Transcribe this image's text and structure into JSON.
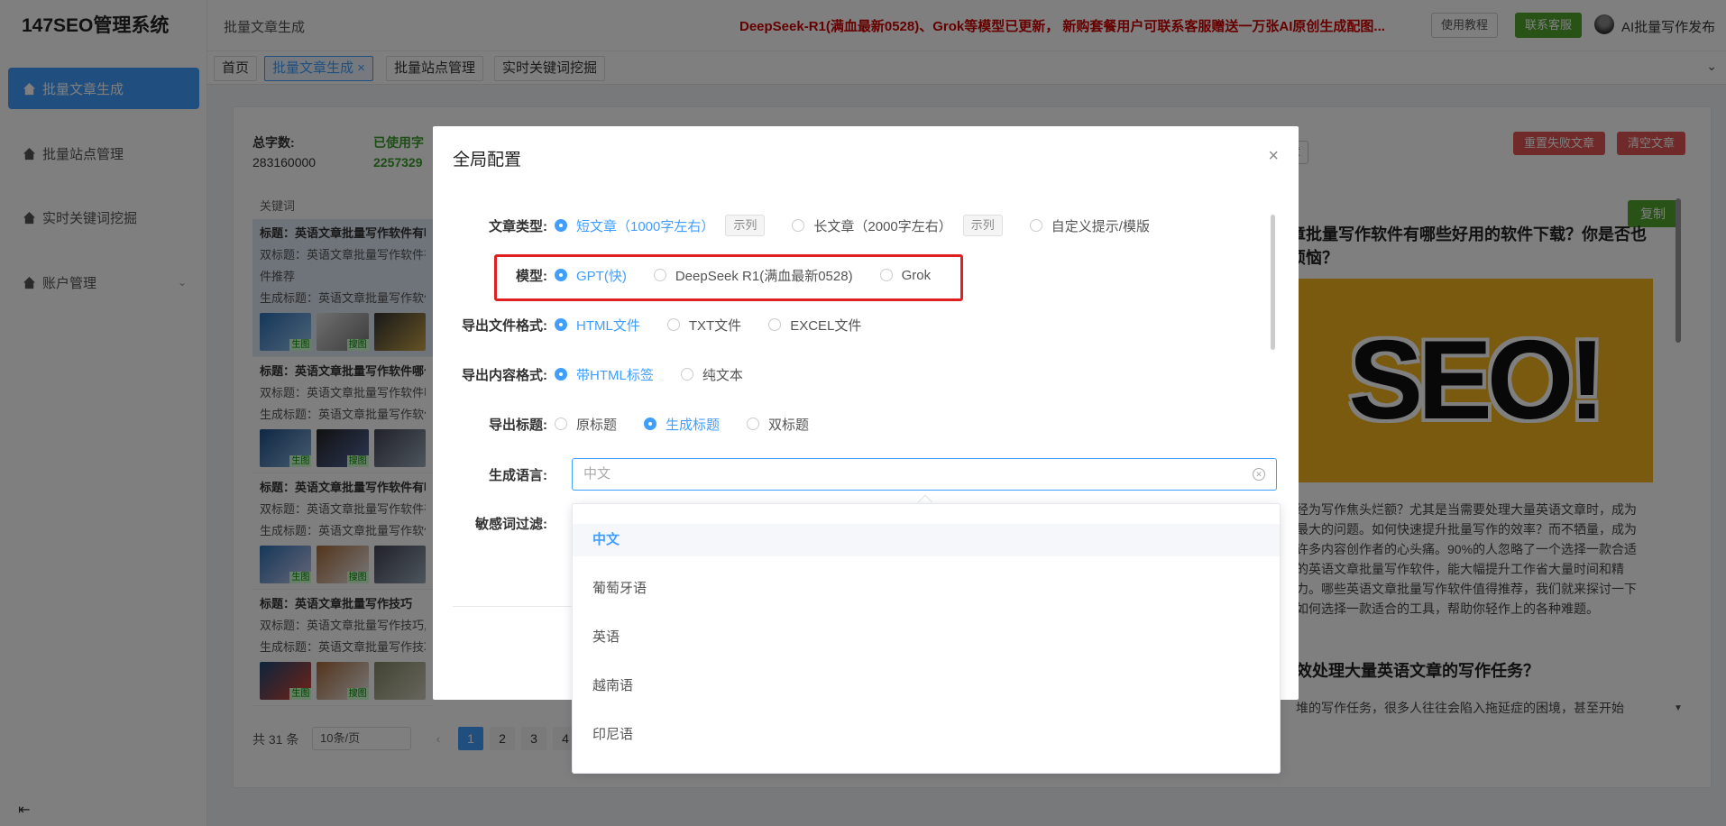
{
  "app": {
    "title": "147SEO管理系统"
  },
  "sidebar": {
    "items": [
      {
        "label": "批量文章生成"
      },
      {
        "label": "批量站点管理"
      },
      {
        "label": "实时关键词挖掘"
      },
      {
        "label": "账户管理"
      }
    ]
  },
  "header": {
    "breadcrumb": "批量文章生成",
    "notice": "DeepSeek-R1(满血最新0528)、Grok等模型已更新， 新购套餐用户可联系客服赠送一万张AI原创生成配图...",
    "tutorial_label": "使用教程",
    "service_label": "联系客服",
    "user_label": "AI批量写作发布"
  },
  "tabs": [
    {
      "label": "首页"
    },
    {
      "label": "批量文章生成 ×"
    },
    {
      "label": "批量站点管理"
    },
    {
      "label": "实时关键词挖掘"
    }
  ],
  "stats": {
    "total_words_label": "总字数:",
    "total_words_value": "283160000",
    "used_label": "已使用字",
    "used_value": "2257329"
  },
  "actions": {
    "reset_failed": "重置失败文章",
    "clear": "清空文章",
    "partial": "章",
    "copy": "复制"
  },
  "list": {
    "header": "关键词",
    "items": [
      {
        "title": "标题：英语文章批量写作软件有哪",
        "dual": "双标题：英语文章批量写作软件有",
        "extra": "件推荐",
        "gen": "生成标题：英语文章批量写作软件"
      },
      {
        "title": "标题：英语文章批量写作软件哪个",
        "dual": "双标题：英语文章批量写作软件哪",
        "gen": "生成标题：英语文章批量写作软件"
      },
      {
        "title": "标题：英语文章批量写作软件有哪",
        "dual": "双标题：英语文章批量写作软件有",
        "gen": "生成标题：英语文章批量写作软件"
      },
      {
        "title": "标题：英语文章批量写作技巧",
        "dual": "双标题：英语文章批量写作技巧,",
        "gen": "生成标题：英语文章批量写作技巧"
      }
    ],
    "thumb_tag_gen": "生图",
    "thumb_tag_search": "搜图"
  },
  "pagination": {
    "total": "共 31 条",
    "per_page": "10条/页",
    "pages": [
      "1",
      "2",
      "3",
      "4"
    ],
    "prev": "‹"
  },
  "article": {
    "title": "章批量写作软件有哪些好用的软件下载？你是否也烦恼？",
    "image_text": "SEO!",
    "body": "经为写作焦头烂额？尤其是当需要处理大量英语文章时，成为最大的问题。如何快速提升批量写作的效率？而不牺量，成为许多内容创作者的心头痛。90%的人忽略了一个选择一款合适的英语文章批量写作软件，能大幅提升工作省大量时间和精力。哪些英语文章批量写作软件值得推荐，我们就来探讨一下如何选择一款适合的工具，帮助你轻作上的各种难题。",
    "h2": "效处理大量英语文章的写作任务？",
    "line": "堆的写作任务，很多人往往会陷入拖延症的困境，甚至开始"
  },
  "modal": {
    "title": "全局配置",
    "close": "×",
    "article_type": {
      "label": "文章类型:",
      "options": [
        "短文章（1000字左右）",
        "长文章（2000字左右）",
        "自定义提示/模版"
      ],
      "example": "示列",
      "selected": 0
    },
    "model": {
      "label": "模型:",
      "options": [
        "GPT(快)",
        "DeepSeek R1(满血最新0528)",
        "Grok"
      ],
      "selected": 0
    },
    "export_format": {
      "label": "导出文件格式:",
      "options": [
        "HTML文件",
        "TXT文件",
        "EXCEL文件"
      ],
      "selected": 0
    },
    "content_format": {
      "label": "导出内容格式:",
      "options": [
        "带HTML标签",
        "纯文本"
      ],
      "selected": 0
    },
    "export_title": {
      "label": "导出标题:",
      "options": [
        "原标题",
        "生成标题",
        "双标题"
      ],
      "selected": 1
    },
    "language": {
      "label": "生成语言:",
      "placeholder": "中文"
    },
    "sensitive": {
      "label": "敏感词过滤:"
    }
  },
  "language_dropdown": {
    "options": [
      "中文",
      "葡萄牙语",
      "英语",
      "越南语",
      "印尼语"
    ],
    "selected": "中文"
  },
  "colors": {
    "primary": "#409eff",
    "green": "#52a52f",
    "danger": "#e05555",
    "highlight": "#e02020"
  }
}
